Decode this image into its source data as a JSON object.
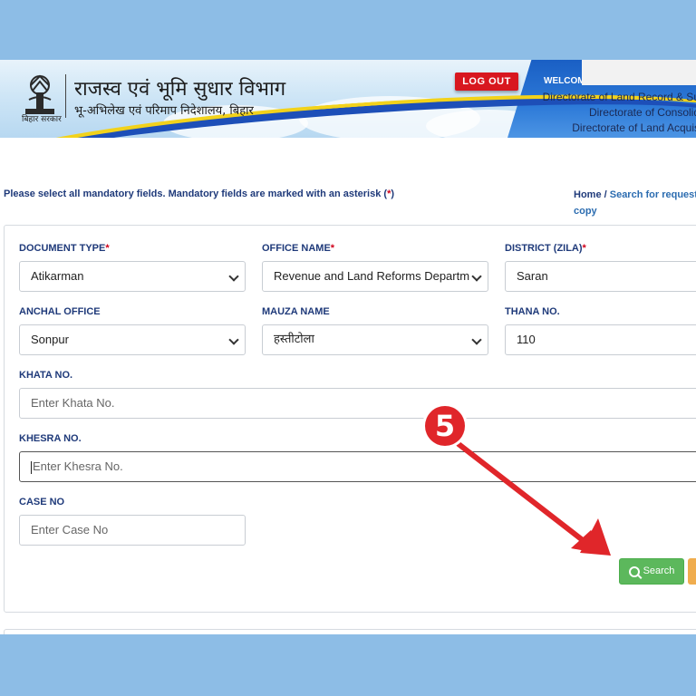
{
  "header": {
    "title_hindi": "राजस्व एवं भूमि सुधार विभाग",
    "subtitle_hindi": "भू-अभिलेख एवं परिमाप निदेशालय, बिहार",
    "emblem_caption": "बिहार सरकार",
    "logout_label": "LOG OUT",
    "welcome_text": "WELCOM",
    "directorates": [
      "Directorate of Land Record & Su",
      "Directorate of Consolid",
      "Directorate of Land Acquis"
    ]
  },
  "notice": {
    "text": "Please select all mandatory fields. Mandatory fields are marked with an asterisk (",
    "asterisk": "*",
    "close": ")"
  },
  "breadcrumb": {
    "home": "Home",
    "separator": " / ",
    "current_line1": "Search for request",
    "current_line2": "copy"
  },
  "form": {
    "document_type": {
      "label": "DOCUMENT TYPE",
      "required": "*",
      "value": "Atikarman"
    },
    "office_name": {
      "label": "OFFICE NAME",
      "required": "*",
      "value": "Revenue and Land Reforms Departm"
    },
    "district": {
      "label": "DISTRICT (ZILA)",
      "required": "*",
      "value": "Saran"
    },
    "anchal_office": {
      "label": "ANCHAL OFFICE",
      "value": "Sonpur"
    },
    "mauza_name": {
      "label": "MAUZA NAME",
      "value": "हस्तीटोला"
    },
    "thana_no": {
      "label": "THANA NO.",
      "value": "110"
    },
    "khata_no": {
      "label": "KHATA NO.",
      "placeholder": "Enter Khata No."
    },
    "khesra_no": {
      "label": "KHESRA NO.",
      "placeholder": "Enter Khesra No."
    },
    "case_no": {
      "label": "CASE NO",
      "placeholder": "Enter Case No"
    },
    "search_label": "Search"
  },
  "annotation": {
    "step_number": "5",
    "color": "#e0262a"
  },
  "colors": {
    "label_blue": "#1f3a7a",
    "required_red": "#d0021b",
    "search_green": "#5cb85c",
    "reset_orange": "#f0ad4e",
    "backdrop": "#8dbde6"
  }
}
